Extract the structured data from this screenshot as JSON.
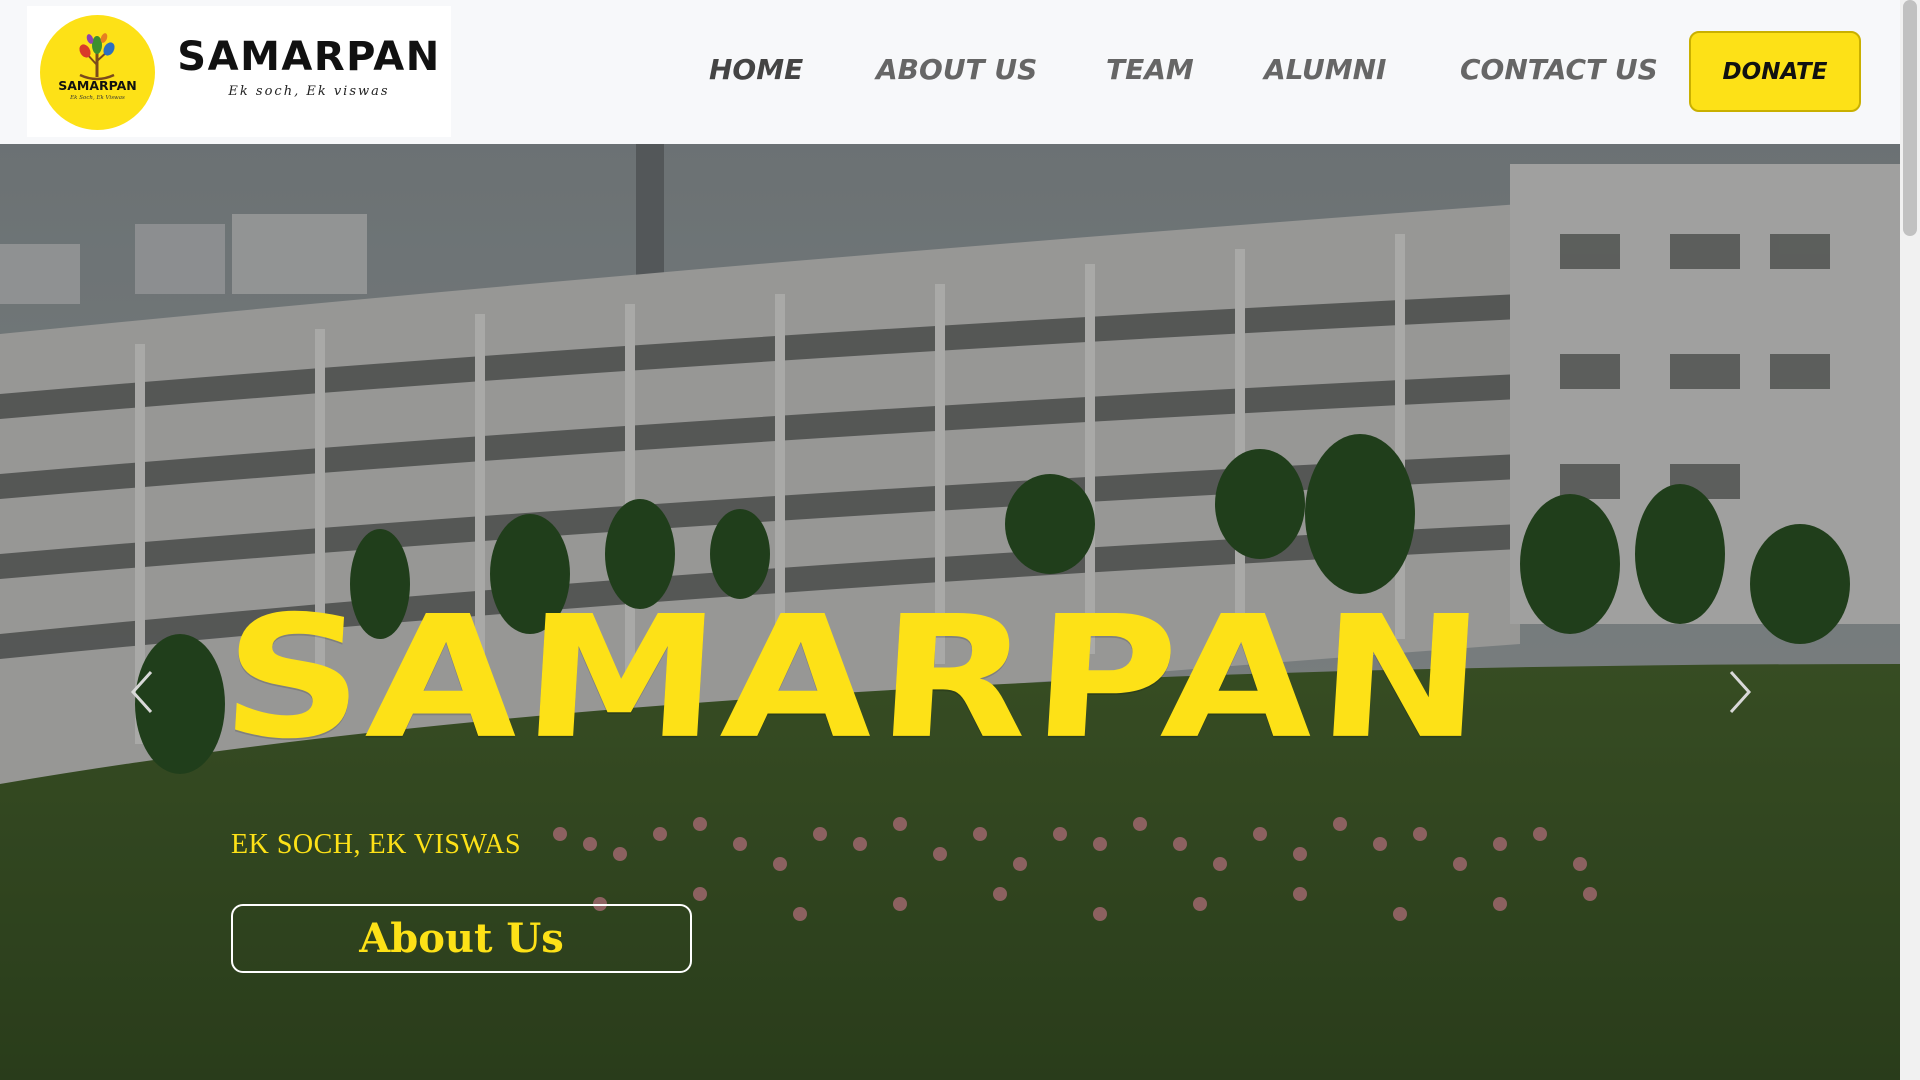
{
  "header": {
    "logo": {
      "title": "SAMARPAN",
      "tagline": "Ek soch, Ek viswas",
      "emblem_word": "SAMARPAN",
      "emblem_tagline": "Ek Soch, Ek Viswas"
    },
    "nav": [
      {
        "label": "HOME",
        "active": true
      },
      {
        "label": "ABOUT US",
        "active": false
      },
      {
        "label": "TEAM",
        "active": false
      },
      {
        "label": "ALUMNI",
        "active": false
      },
      {
        "label": "CONTACT US",
        "active": false
      }
    ],
    "donate_label": "DONATE"
  },
  "hero": {
    "title": "SAMARPAN",
    "subtitle": "EK SOCH, EK VISWAS",
    "button_label": "About Us",
    "prev_icon": "chevron-left-icon",
    "next_icon": "chevron-right-icon"
  },
  "colors": {
    "accent": "#fde117",
    "header_bg": "#f7f8fa",
    "nav_text": "#666666",
    "grass": "#3f5a2a"
  }
}
